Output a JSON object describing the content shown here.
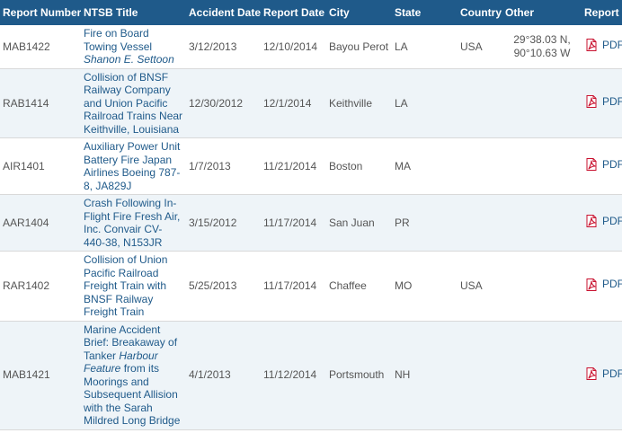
{
  "table": {
    "headers": {
      "report_number": "Report Number",
      "title": "NTSB Title",
      "accident_date": "Accident Date",
      "report_date": "Report Date",
      "city": "City",
      "state": "State",
      "country": "Country",
      "other": "Other",
      "report": "Report"
    },
    "rows": [
      {
        "report_number": "MAB1422",
        "title_main": "Fire on Board Towing Vessel",
        "title_italic": "Shanon E. Settoon",
        "title_rest": "",
        "accident_date": "3/12/2013",
        "report_date": "12/10/2014",
        "city": "Bayou Perot",
        "state": "LA",
        "country": "USA",
        "other_line1": "29°38.03 N,",
        "other_line2": "90°10.63 W",
        "report": "PDF"
      },
      {
        "report_number": "RAB1414",
        "title_main": "Collision of BNSF Railway Company and Union Pacific Railroad Trains Near Keithville, Louisiana",
        "title_italic": "",
        "title_rest": "",
        "accident_date": "12/30/2012",
        "report_date": "12/1/2014",
        "city": "Keithville",
        "state": "LA",
        "country": "",
        "other_line1": "",
        "other_line2": "",
        "report": "PDF"
      },
      {
        "report_number": "AIR1401",
        "title_main": "Auxiliary Power Unit Battery Fire Japan Airlines Boeing 787-8, JA829J",
        "title_italic": "",
        "title_rest": "",
        "accident_date": "1/7/2013",
        "report_date": "11/21/2014",
        "city": "Boston",
        "state": "MA",
        "country": "",
        "other_line1": "",
        "other_line2": "",
        "report": "PDF"
      },
      {
        "report_number": "AAR1404",
        "title_main": "Crash Following In-Flight Fire Fresh Air, Inc. Convair CV-440-38, N153JR",
        "title_italic": "",
        "title_rest": "",
        "accident_date": "3/15/2012",
        "report_date": "11/17/2014",
        "city": "San Juan",
        "state": "PR",
        "country": "",
        "other_line1": "",
        "other_line2": "",
        "report": "PDF"
      },
      {
        "report_number": "RAR1402",
        "title_main": "Collision of Union Pacific Railroad Freight Train with BNSF Railway Freight Train",
        "title_italic": "",
        "title_rest": "",
        "accident_date": "5/25/2013",
        "report_date": "11/17/2014",
        "city": "Chaffee",
        "state": "MO",
        "country": "USA",
        "other_line1": "",
        "other_line2": "",
        "report": "PDF"
      },
      {
        "report_number": "MAB1421",
        "title_main": "Marine Accident Brief: Breakaway of Tanker",
        "title_italic": "Harbour Feature",
        "title_rest": "from its Moorings and Subsequent Allision with the Sarah Mildred Long Bridge",
        "accident_date": "4/1/2013",
        "report_date": "11/12/2014",
        "city": "Portsmouth",
        "state": "NH",
        "country": "",
        "other_line1": "",
        "other_line2": "",
        "report": "PDF"
      }
    ]
  },
  "icons": {
    "report": "pdf-icon"
  },
  "colors": {
    "header_bg": "#1f5a8a",
    "link": "#1f5a8a",
    "row_alt": "#eef4f8",
    "pdf_red": "#c8102e"
  }
}
